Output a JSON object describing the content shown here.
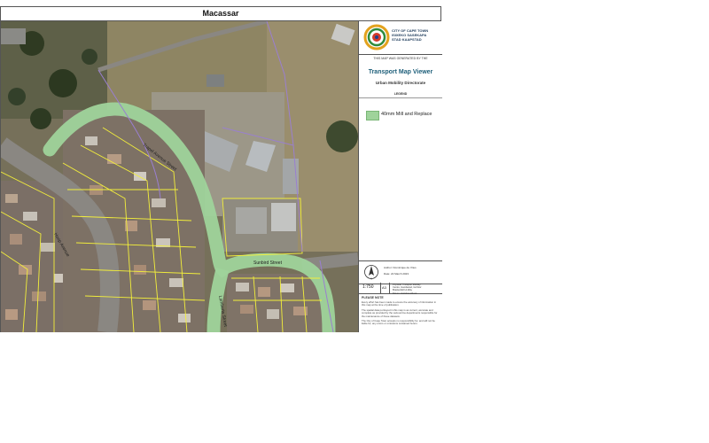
{
  "title": "Macassar",
  "logo": {
    "line1": "CITY OF CAPE TOWN",
    "line2": "ISIXEKO SASEKAPA",
    "line3": "STAD KAAPSTAD"
  },
  "generated_note": "THIS MAP WAS GENERATED BY THE",
  "viewer_title": "Transport Map Viewer",
  "directorate": "Urban Mobility Directorate",
  "legend": {
    "heading": "LEGEND",
    "items": [
      {
        "label": "40mm Mill and Replace",
        "color": "#9fd39b"
      }
    ]
  },
  "meta": {
    "author": "Author: Dominique de Vries",
    "date": "Date: 22 March 2023"
  },
  "scale": "1:750",
  "paper_size": "A3",
  "address": [
    "Physical: Transport Mobility",
    "Centre, Goodwood, 1st floor",
    "Brackenfell Hi-Way",
    "Datum: Hartebeesthoek"
  ],
  "notes_heading": "PLEASE NOTE",
  "notes": [
    "Every effort has been made to ensure the accuracy of information in this map at the time of publication.",
    "The spatial data portrayed in this map is as current, accurate and complete as provided by the various line departments responsible for the maintenance of these datasets.",
    "The City of Cape Town accepts no responsibility for, and will not be liable for, any errors or omissions contained herein."
  ],
  "roads": {
    "r1": "Trapel Avenue Street",
    "r2": "Hoop Avenue",
    "r3": "Sunbird Street",
    "r4": "Lamberts Street"
  },
  "colors": {
    "aerial_base": "#6f6a55",
    "mill_replace": "#9fd39b",
    "cadastral": "#f3ef3b",
    "brand": "#1e5f7a"
  }
}
